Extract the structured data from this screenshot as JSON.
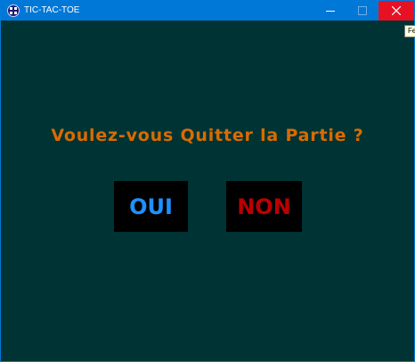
{
  "window": {
    "title": "TIC-TAC-TOE",
    "tooltip": "Fe"
  },
  "icons": {
    "app": "app-icon",
    "minimize": "minimize-icon",
    "maximize": "maximize-icon",
    "close": "close-icon"
  },
  "dialog": {
    "question": "Voulez-vous Quitter la Partie ?",
    "yes_label": "OUI",
    "no_label": "NON"
  },
  "colors": {
    "background": "#003333",
    "titlebar": "#0078d7",
    "close_hover": "#e81123",
    "question_text": "#d96b00",
    "yes_text": "#1e90ff",
    "no_text": "#bb0000",
    "button_bg": "#000000"
  }
}
